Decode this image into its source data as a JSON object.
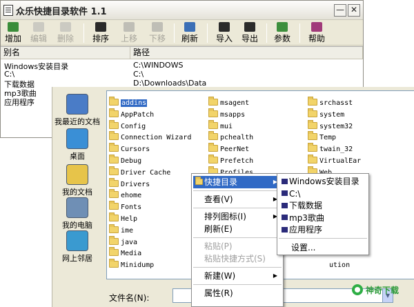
{
  "app": {
    "title": "众乐快捷目录软件 1.1",
    "minimize": "—",
    "close": "✕"
  },
  "toolbar": [
    {
      "label": "增加",
      "icon": "add-icon",
      "enabled": true
    },
    {
      "label": "编辑",
      "icon": "edit-icon",
      "enabled": false
    },
    {
      "label": "删除",
      "icon": "delete-icon",
      "enabled": false
    },
    {
      "label": "排序",
      "icon": "sort-icon",
      "enabled": true
    },
    {
      "label": "上移",
      "icon": "move-up-icon",
      "enabled": false
    },
    {
      "label": "下移",
      "icon": "move-down-icon",
      "enabled": false
    },
    {
      "label": "刷新",
      "icon": "refresh-icon",
      "enabled": true
    },
    {
      "label": "导入",
      "icon": "import-icon",
      "enabled": true
    },
    {
      "label": "导出",
      "icon": "export-icon",
      "enabled": true
    },
    {
      "label": "参数",
      "icon": "settings-icon",
      "enabled": true
    },
    {
      "label": "帮助",
      "icon": "help-book-icon",
      "enabled": true
    }
  ],
  "list": {
    "columns": [
      "别名",
      "路径"
    ],
    "rows": [
      {
        "alias": "Windows安装目录",
        "path": "C:\\WINDOWS"
      },
      {
        "alias": "C:\\",
        "path": "C:\\"
      },
      {
        "alias": "下载数据",
        "path": "D:\\Downloads\\Data"
      },
      {
        "alias": "mp3歌曲",
        "path": ""
      },
      {
        "alias": "应用程序",
        "path": ""
      }
    ]
  },
  "dialog": {
    "places": [
      {
        "label": "我最近的文档",
        "icon": "recent-documents-icon"
      },
      {
        "label": "桌面",
        "icon": "desktop-icon"
      },
      {
        "label": "我的文档",
        "icon": "my-documents-icon"
      },
      {
        "label": "我的电脑",
        "icon": "my-computer-icon"
      },
      {
        "label": "网上邻居",
        "icon": "network-places-icon"
      }
    ],
    "columns": [
      [
        "addins",
        "AppPatch",
        "Config",
        "Connection Wizard",
        "Cursors",
        "Debug",
        "Driver Cache",
        "Drivers",
        "ehome",
        "Fonts",
        "Help",
        "ime",
        "java",
        "Media",
        "Minidump"
      ],
      [
        "msagent",
        "msapps",
        "mui",
        "pchealth",
        "PeerNet",
        "Prefetch",
        "Profiles"
      ],
      [
        "srchasst",
        "system",
        "system32",
        "Temp",
        "twain_32",
        "VirtualEar",
        "Web"
      ]
    ],
    "partial_item": "ution",
    "filename_label": "文件名(N):",
    "filename_value": ""
  },
  "context_menu": {
    "items": [
      {
        "label": "快捷目录",
        "submenu": true,
        "highlighted": true,
        "enabled": true
      },
      {
        "separator": true
      },
      {
        "label": "查看(V)",
        "submenu": true,
        "enabled": true
      },
      {
        "separator": true
      },
      {
        "label": "排列图标(I)",
        "submenu": true,
        "enabled": true
      },
      {
        "label": "刷新(E)",
        "submenu": false,
        "enabled": true
      },
      {
        "separator": true
      },
      {
        "label": "粘贴(P)",
        "submenu": false,
        "enabled": false
      },
      {
        "label": "粘贴快捷方式(S)",
        "submenu": false,
        "enabled": false
      },
      {
        "separator": true
      },
      {
        "label": "新建(W)",
        "submenu": true,
        "enabled": true
      },
      {
        "separator": true
      },
      {
        "label": "属性(R)",
        "submenu": false,
        "enabled": true
      }
    ]
  },
  "submenu": {
    "items": [
      "Windows安装目录",
      "C:\\",
      "下载数据",
      "mp3歌曲",
      "应用程序"
    ],
    "settings": "设置..."
  },
  "logo": {
    "text": "神奇下载"
  },
  "colors": {
    "highlight": "#316ac5",
    "folder": "#f2d46a",
    "window_bg": "#ece9d8",
    "logo": "#2e9b3b"
  }
}
